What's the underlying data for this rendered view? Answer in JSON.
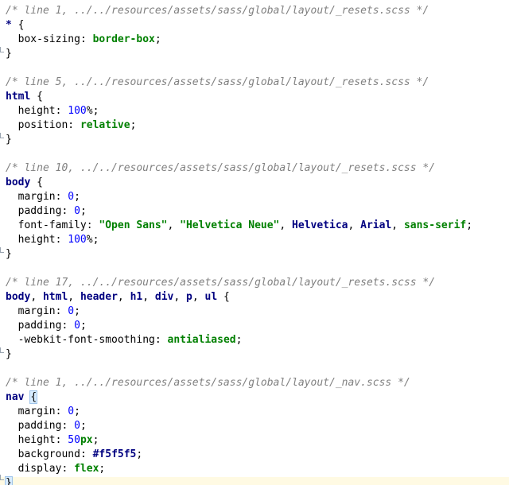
{
  "editor": {
    "colors": {
      "comment": "#808080",
      "selector": "#000080",
      "keyword": "#008000",
      "number": "#0000ff",
      "current_line": "#fffae3"
    },
    "lines": {
      "l1": "/* line 1, ../../resources/assets/sass/global/layout/_resets.scss */",
      "l2_sel": "*",
      "l2_brace": "{",
      "l3_prop": "box-sizing",
      "l3_val": "border-box",
      "l4": "}",
      "l6": "/* line 5, ../../resources/assets/sass/global/layout/_resets.scss */",
      "l7_sel": "html",
      "l7_brace": "{",
      "l8_prop": "height",
      "l8_num": "100",
      "l8_unit": "%",
      "l9_prop": "position",
      "l9_val": "relative",
      "l10": "}",
      "l12": "/* line 10, ../../resources/assets/sass/global/layout/_resets.scss */",
      "l13_sel": "body",
      "l13_brace": "{",
      "l14_prop": "margin",
      "l14_num": "0",
      "l15_prop": "padding",
      "l15_num": "0",
      "l16_prop": "font-family",
      "l16_v1": "\"Open Sans\"",
      "l16_v2": "\"Helvetica Neue\"",
      "l16_v3": "Helvetica",
      "l16_v4": "Arial",
      "l16_v5": "sans-serif",
      "l17_prop": "height",
      "l17_num": "100",
      "l17_unit": "%",
      "l18": "}",
      "l20": "/* line 17, ../../resources/assets/sass/global/layout/_resets.scss */",
      "l21_s1": "body",
      "l21_s2": "html",
      "l21_s3": "header",
      "l21_s4": "h1",
      "l21_s5": "div",
      "l21_s6": "p",
      "l21_s7": "ul",
      "l21_brace": "{",
      "l22_prop": "margin",
      "l22_num": "0",
      "l23_prop": "padding",
      "l23_num": "0",
      "l24_prop": "-webkit-font-smoothing",
      "l24_val": "antialiased",
      "l25": "}",
      "l27": "/* line 1, ../../resources/assets/sass/global/layout/_nav.scss */",
      "l28_sel": "nav",
      "l28_brace": "{",
      "l29_prop": "margin",
      "l29_num": "0",
      "l30_prop": "padding",
      "l30_num": "0",
      "l31_prop": "height",
      "l31_num": "50",
      "l31_unit": "px",
      "l32_prop": "background",
      "l32_val": "#f5f5f5",
      "l33_prop": "display",
      "l33_val": "flex",
      "l34": "}"
    }
  }
}
